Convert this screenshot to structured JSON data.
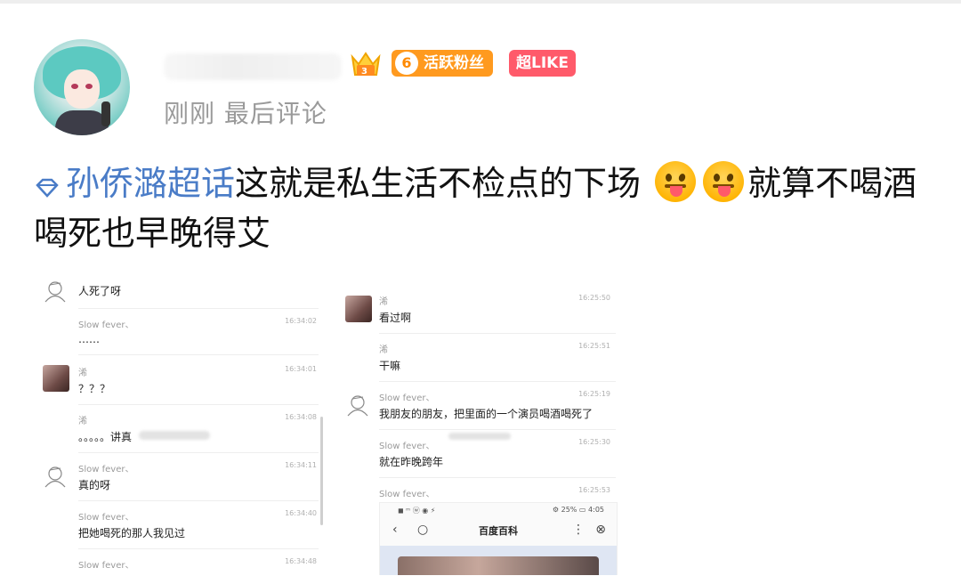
{
  "post": {
    "username": "",
    "fan_badge": {
      "level": "6",
      "label": "活跃粉丝"
    },
    "like_badge": "超LIKE",
    "meta": "刚刚 最后评论",
    "topic": "孙侨潞超话",
    "text_before_emoji": "这就是私生活不检点的下场",
    "text_after_emoji": "就算不喝酒喝死也早晚得艾",
    "emoji_names": [
      "tongue-out-emoji",
      "tongue-out-emoji"
    ]
  },
  "screenshot_left": {
    "messages": [
      {
        "name": "",
        "time": "",
        "text": "人死了呀"
      },
      {
        "name": "Slow fever、",
        "time": "16:34:02",
        "text": "……"
      },
      {
        "name": "浠",
        "time": "16:34:01",
        "text": "？？？"
      },
      {
        "name": "浠",
        "time": "16:34:08",
        "text": "。。。。。讲真"
      },
      {
        "name": "Slow fever、",
        "time": "16:34:11",
        "text": "真的呀"
      },
      {
        "name": "Slow fever、",
        "time": "16:34:40",
        "text": "把她喝死的那人我见过"
      },
      {
        "name": "Slow fever、",
        "time": "16:34:48",
        "text": ""
      }
    ]
  },
  "screenshot_right": {
    "messages": [
      {
        "name": "浠",
        "time": "16:25:50",
        "text": "看过啊"
      },
      {
        "name": "浠",
        "time": "16:25:51",
        "text": "干嘛"
      },
      {
        "name": "Slow fever、",
        "time": "16:25:19",
        "text": "我朋友的朋友，把里面的一个演员喝酒喝死了"
      },
      {
        "name": "Slow fever、",
        "time": "16:25:30",
        "text": "就在昨晚跨年"
      },
      {
        "name": "Slow fever、",
        "time": "16:25:53",
        "text": ""
      }
    ],
    "phone": {
      "status_left": "◼ ᵐ ⓦ ◉ ⚡",
      "status_right": "⚙ 25% ▭ 4:05",
      "title": "百度百科"
    }
  },
  "colors": {
    "topic_blue": "#4a7cc7",
    "fan_badge_orange": "#ff9a1f",
    "like_badge_red": "#ff5a6a",
    "meta_gray": "#9a9a9a"
  }
}
